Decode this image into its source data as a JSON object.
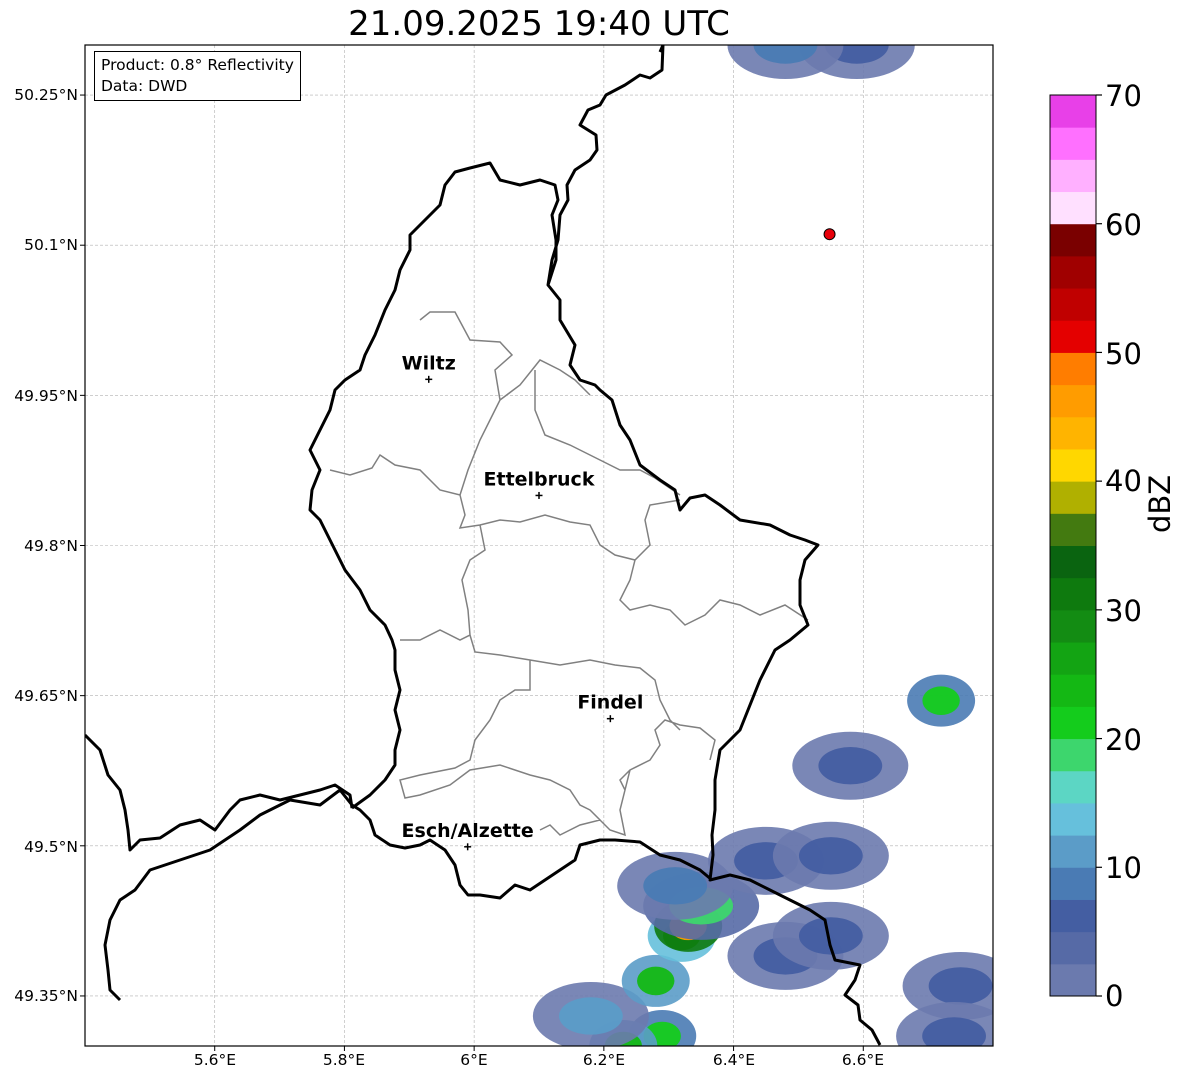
{
  "title": "21.09.2025 19:40 UTC",
  "info": {
    "product": "Product: 0.8° Reflectivity",
    "source": "Data: DWD"
  },
  "lat_ticks": [
    "50.25°N",
    "50.1°N",
    "49.95°N",
    "49.8°N",
    "49.65°N",
    "49.5°N",
    "49.35°N"
  ],
  "lon_ticks": [
    "5.6°E",
    "5.8°E",
    "6°E",
    "6.2°E",
    "6.4°E",
    "6.6°E"
  ],
  "cities": [
    {
      "name": "Wiltz",
      "lon": 5.93,
      "lat": 49.966
    },
    {
      "name": "Ettelbruck",
      "lon": 6.1,
      "lat": 49.85
    },
    {
      "name": "Findel",
      "lon": 6.21,
      "lat": 49.627
    },
    {
      "name": "Esch/Alzette",
      "lon": 5.99,
      "lat": 49.499
    }
  ],
  "radar_site": {
    "lon": 6.548,
    "lat": 50.111,
    "color": "#e8000b"
  },
  "colorbar": {
    "label": "dBZ",
    "ticks": [
      "0",
      "10",
      "20",
      "30",
      "40",
      "50",
      "60",
      "70"
    ],
    "min": 0,
    "max": 70,
    "step": 2.5,
    "colors": [
      "#6b7aae",
      "#566aa6",
      "#445ea2",
      "#4a7bb4",
      "#5b9cc8",
      "#66c0dc",
      "#5cd6c4",
      "#3dd66d",
      "#14cc1c",
      "#14b814",
      "#13a413",
      "#138c13",
      "#0e7a0e",
      "#0a6410",
      "#437a10",
      "#b0b000",
      "#ffd700",
      "#ffb400",
      "#ff9c00",
      "#ff7d00",
      "#e40000",
      "#c00000",
      "#a00000",
      "#7a0000",
      "#ffe0ff",
      "#ffb0ff",
      "#ff70ff",
      "#e840e8"
    ]
  },
  "map": {
    "lon_range": [
      5.4,
      6.8
    ],
    "lat_range": [
      49.3,
      50.3
    ],
    "grid": true,
    "country_border_color": "#000000",
    "canton_border_color": "#808080"
  },
  "echoes": [
    {
      "lon": 6.29,
      "lat": 49.31,
      "dbz": 22
    },
    {
      "lon": 6.23,
      "lat": 49.3,
      "dbz": 24
    },
    {
      "lon": 6.18,
      "lat": 49.33,
      "dbz": 12
    },
    {
      "lon": 6.28,
      "lat": 49.365,
      "dbz": 24
    },
    {
      "lon": 6.32,
      "lat": 49.41,
      "dbz": 27
    },
    {
      "lon": 6.33,
      "lat": 49.42,
      "dbz": 45
    },
    {
      "lon": 6.35,
      "lat": 49.44,
      "dbz": 18
    },
    {
      "lon": 6.31,
      "lat": 49.46,
      "dbz": 9
    },
    {
      "lon": 6.45,
      "lat": 49.485,
      "dbz": 7
    },
    {
      "lon": 6.55,
      "lat": 49.49,
      "dbz": 6
    },
    {
      "lon": 6.48,
      "lat": 49.39,
      "dbz": 6
    },
    {
      "lon": 6.55,
      "lat": 49.41,
      "dbz": 5
    },
    {
      "lon": 6.75,
      "lat": 49.36,
      "dbz": 5
    },
    {
      "lon": 6.74,
      "lat": 49.31,
      "dbz": 5
    },
    {
      "lon": 6.72,
      "lat": 49.645,
      "dbz": 22
    },
    {
      "lon": 6.58,
      "lat": 49.58,
      "dbz": 5
    },
    {
      "lon": 6.59,
      "lat": 50.3,
      "dbz": 5
    },
    {
      "lon": 6.48,
      "lat": 50.3,
      "dbz": 8
    }
  ]
}
